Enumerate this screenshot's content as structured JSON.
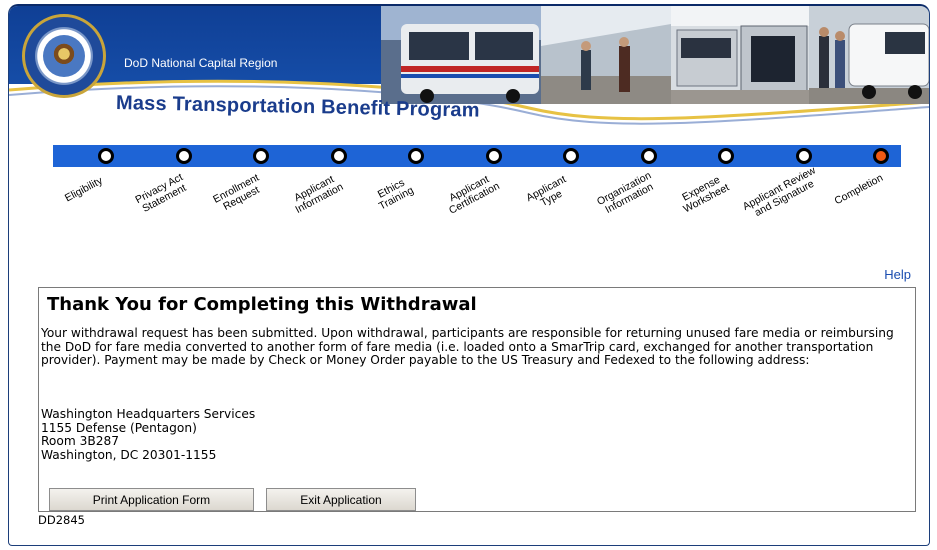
{
  "header": {
    "region": "DoD National Capital Region",
    "program_title": "Mass Transportation Benefit Program",
    "seal_label": "Department of Defense seal",
    "colors": {
      "banner": "#0f3f95",
      "title": "#1a3c8c"
    }
  },
  "progress": {
    "track_color": "#1e64d6",
    "current_color": "#f05a14",
    "steps": [
      {
        "label": "Eligibility",
        "current": false
      },
      {
        "label": "Privacy Act\nStatement",
        "current": false
      },
      {
        "label": "Enrollment\nRequest",
        "current": false
      },
      {
        "label": "Applicant\nInformation",
        "current": false
      },
      {
        "label": "Ethics\nTraining",
        "current": false
      },
      {
        "label": "Applicant\nCertification",
        "current": false
      },
      {
        "label": "Applicant\nType",
        "current": false
      },
      {
        "label": "Organization\nInformation",
        "current": false
      },
      {
        "label": "Expense\nWorksheet",
        "current": false
      },
      {
        "label": "Applicant Review\nand Signature",
        "current": false
      },
      {
        "label": "Completion",
        "current": true
      }
    ]
  },
  "help_link": "Help",
  "main": {
    "title": "Thank You for Completing this Withdrawal",
    "paragraph": "Your withdrawal request has been submitted. Upon withdrawal, participants are responsible for returning unused fare media or reimbursing the DoD for fare media converted to another form of fare media (i.e. loaded onto a SmarTrip card, exchanged for another transportation provider). Payment may be made by Check or Money Order payable to the US Treasury and Fedexed to the following address:",
    "address": [
      "Washington Headquarters Services",
      "1155 Defense (Pentagon)",
      "Room 3B287",
      "Washington, DC 20301-1155"
    ],
    "print_button": "Print Application Form",
    "exit_button": "Exit Application"
  },
  "form_code": "DD2845"
}
